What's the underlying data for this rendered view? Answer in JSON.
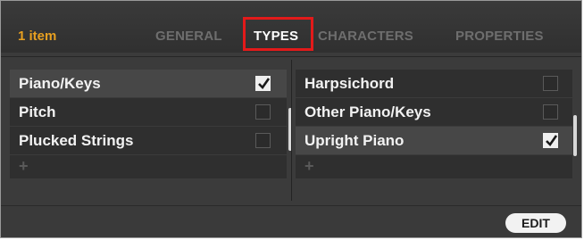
{
  "header": {
    "item_count": "1 item",
    "tabs": [
      {
        "label": "GENERAL",
        "active": false
      },
      {
        "label": "TYPES",
        "active": true
      },
      {
        "label": "CHARACTERS",
        "active": false
      },
      {
        "label": "PROPERTIES",
        "active": false
      }
    ]
  },
  "left_column": {
    "items": [
      {
        "label": "Piano/Keys",
        "checked": true,
        "selected": true
      },
      {
        "label": "Pitch",
        "checked": false,
        "selected": false
      },
      {
        "label": "Plucked Strings",
        "checked": false,
        "selected": false
      }
    ],
    "add_label": "+"
  },
  "right_column": {
    "items": [
      {
        "label": "Harpsichord",
        "checked": false,
        "selected": false
      },
      {
        "label": "Other Piano/Keys",
        "checked": false,
        "selected": false
      },
      {
        "label": "Upright Piano",
        "checked": true,
        "selected": true
      }
    ],
    "add_label": "+"
  },
  "footer": {
    "edit_label": "EDIT"
  },
  "colors": {
    "accent": "#e8a020",
    "highlight": "#e31a1a",
    "panel_bg": "#3b3b3b",
    "row_bg": "#2f2f2f",
    "row_selected_bg": "#474747"
  }
}
